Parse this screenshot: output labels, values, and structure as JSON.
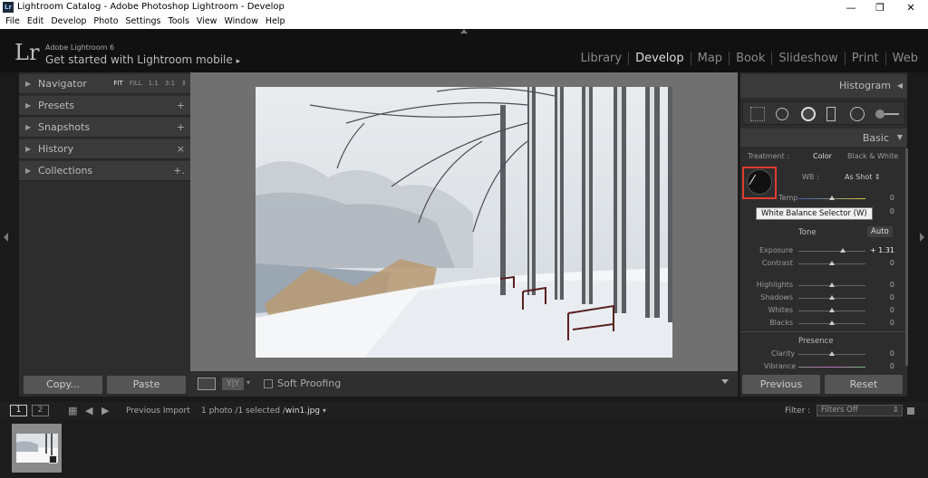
{
  "window": {
    "title": "Lightroom Catalog - Adobe Photoshop Lightroom - Develop",
    "app_icon": "Lr"
  },
  "menu": [
    "File",
    "Edit",
    "Develop",
    "Photo",
    "Settings",
    "Tools",
    "View",
    "Window",
    "Help"
  ],
  "identity": {
    "logo": "Lr",
    "line1": "Adobe Lightroom 6",
    "line2": "Get started with Lightroom mobile",
    "arrow": "▸"
  },
  "modules": [
    "Library",
    "Develop",
    "Map",
    "Book",
    "Slideshow",
    "Print",
    "Web"
  ],
  "active_module": "Develop",
  "left_panel": {
    "navigator": {
      "label": "Navigator",
      "options": [
        "FIT",
        "FILL",
        "1:1",
        "3:1"
      ]
    },
    "presets": {
      "label": "Presets",
      "action": "+"
    },
    "snapshots": {
      "label": "Snapshots",
      "action": "+"
    },
    "history": {
      "label": "History",
      "action": "×"
    },
    "collections": {
      "label": "Collections",
      "action": "+."
    },
    "copy_label": "Copy...",
    "paste_label": "Paste"
  },
  "toolbar": {
    "soft_proofing": "Soft Proofing"
  },
  "right_panel": {
    "histogram_label": "Histogram",
    "basic_label": "Basic",
    "treatment_label": "Treatment :",
    "treatment_color": "Color",
    "treatment_bw": "Black & White",
    "wb_label": "WB :",
    "wb_value": "As Shot",
    "temp_label": "Temp",
    "temp_value": "0",
    "tint_value": "0",
    "tooltip": "White Balance Selector (W)",
    "tone_label": "Tone",
    "auto_label": "Auto",
    "sliders": [
      {
        "label": "Exposure",
        "value": "+ 1.31",
        "level": 0.66
      },
      {
        "label": "Contrast",
        "value": "0",
        "level": 0.5
      },
      {
        "label": "Highlights",
        "value": "0",
        "level": 0.5
      },
      {
        "label": "Shadows",
        "value": "0",
        "level": 0.5
      },
      {
        "label": "Whites",
        "value": "0",
        "level": 0.5
      },
      {
        "label": "Blacks",
        "value": "0",
        "level": 0.5
      }
    ],
    "presence_label": "Presence",
    "clarity": {
      "label": "Clarity",
      "value": "0"
    },
    "vibrance": {
      "label": "Vibrance",
      "value": "0"
    },
    "previous_label": "Previous",
    "reset_label": "Reset"
  },
  "filmstrip": {
    "page1": "1",
    "page2": "2",
    "source": "Previous Import",
    "count": "1 photo /1 selected /",
    "filename": "win1.jpg",
    "filter_label": "Filter :",
    "filter_value": "Filters Off"
  },
  "colors": {
    "highlight_box": "#e03c31",
    "panel_bg": "#2d2d2d",
    "center_bg": "#707070"
  }
}
